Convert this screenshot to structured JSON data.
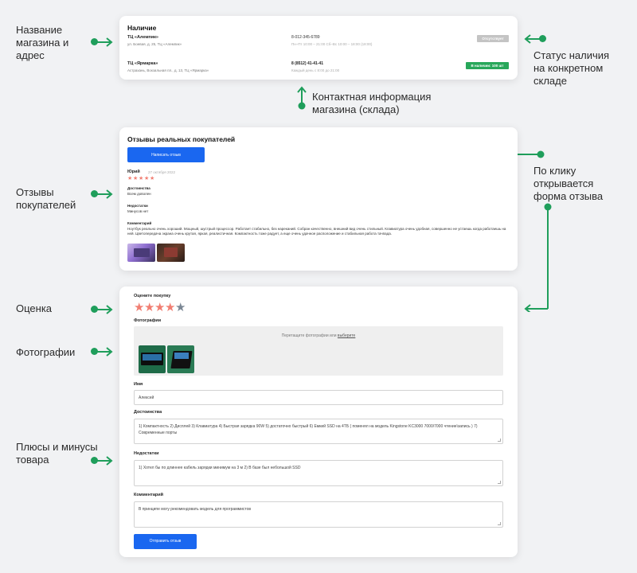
{
  "annotations": {
    "store_name_address": "Название\nмагазина и\nадрес",
    "stock_status": "Статус наличия\nна конкретном\nскладе",
    "store_contacts": "Контактная информация\nмагазина (склада)",
    "click_opens_form": "По клику\nоткрывается\nформа отзыва",
    "customer_reviews": "Отзывы\nпокупателей",
    "rating": "Оценка",
    "photos": "Фотографии",
    "pros_cons": "Плюсы и минусы\nтовара"
  },
  "stock": {
    "title": "Наличие",
    "stores": [
      {
        "name": "ТЦ «Алемпик»",
        "address": "ул. Боевая, д. 25, ТЦ «Алемпик»",
        "phone": "8-012-345-6789",
        "hours": "Пн–Пт 10:00 – 21:00 Сб–Вс 10:00 – 18:00 (18:00)",
        "status": "Отсутствует",
        "status_color": "#c4c4c4"
      },
      {
        "name": "ТЦ «Ярмарка»",
        "address": "Астрахань, Вокзальная пл., д. 13, ТЦ «Ярмарка»",
        "phone": "8 (8512) 41-41-41",
        "hours": "Каждый день с 8:00 до 21:00",
        "status": "В наличии: 100 шт",
        "status_color": "#28a75a"
      }
    ]
  },
  "reviews": {
    "title": "Отзывы реальных покупателей",
    "write_button": "Написать отзыв",
    "review": {
      "author": "Юрий",
      "date": "27 октября 2022",
      "rating": 5,
      "pros_label": "Достоинства",
      "pros": "Всем доволен",
      "cons_label": "Недостатки",
      "cons": "Минусов нет",
      "comment_label": "Комментарий",
      "comment": "Ноутбук реально очень хороший. Мощный, шустрый процессор. Работает стабильно, без нареканий. Собран качественно, внешний вид очень стильный. Клавиатура очень удобная, совершенно не устаешь когда работаешь на ней. Цветопередача экрана очень крутая, яркая, реалистичная. Компактность тоже радует, а еще очень удачное расположение и стабильная работа тачпада."
    }
  },
  "form": {
    "rate_label": "Оцените покупку",
    "rating": 4,
    "photos_label": "Фотографии",
    "dropzone_text": "Перетащите фотографии или",
    "dropzone_link": "выберите",
    "name_label": "Имя",
    "name_value": "Алексей",
    "pros_label": "Достоинства",
    "pros_value": "1) Компактность 2) Дисплей 3) Клавиатура 4) Быстрая зарядка 90W 5) достаточно быстрый 6) Емкий SSD на 4ТБ ( поменял на модель Kingstone KC3000 7000/7000 чтение\\запись ) 7) Современные порты",
    "cons_label": "Недостатки",
    "cons_value": "1) Хотел бы по длиннее кабель зарядки минимум на 3 м 2) В базе был небольшой SSD",
    "comment_label": "Комментарий",
    "comment_value": "В принципе могу рекомендовать модель для программистов",
    "submit_button": "Отправить отзыв"
  },
  "colors": {
    "accent_green": "#1f9e5b",
    "button_blue": "#1a67f0",
    "star_active": "#f17e72",
    "star_inactive": "#7b8794"
  }
}
